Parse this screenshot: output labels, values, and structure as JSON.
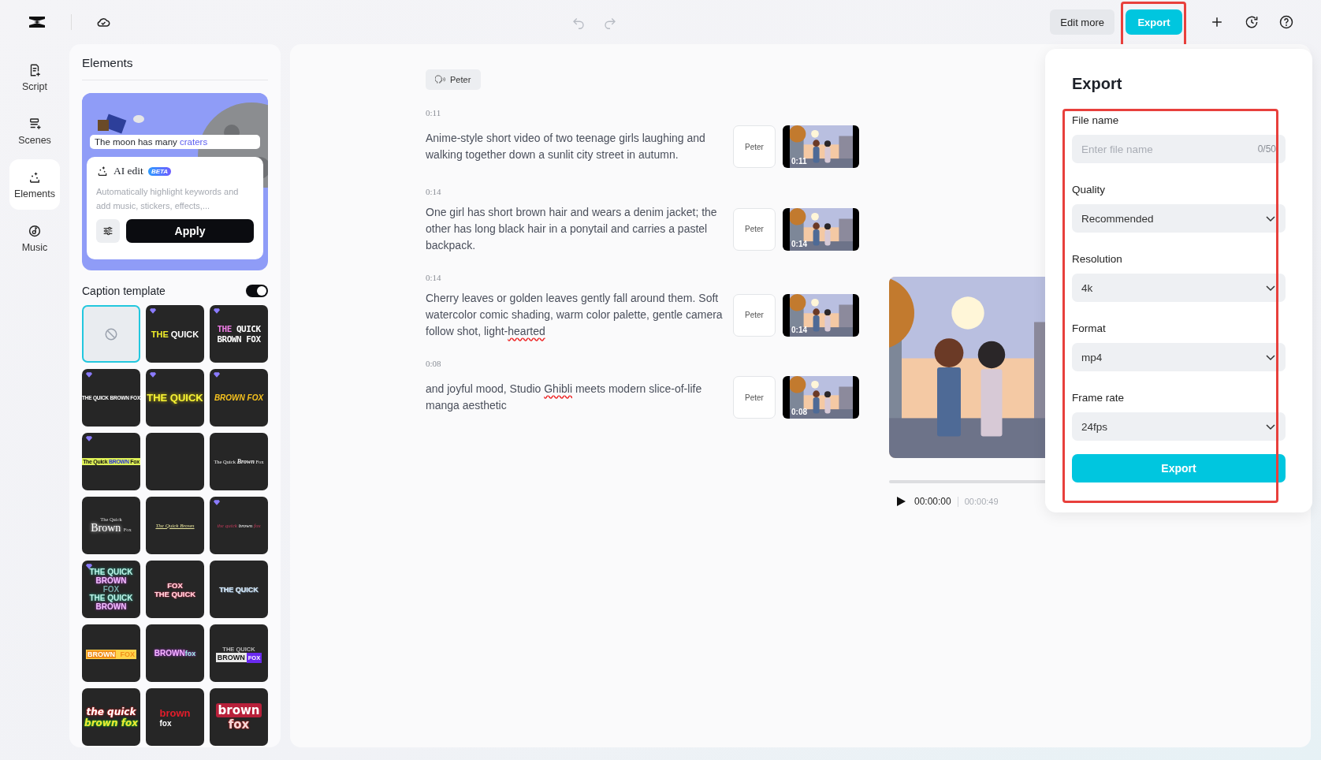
{
  "toolbar": {
    "undo": {
      "disabled": true
    },
    "redo": {
      "disabled": true
    },
    "edit_more": "Edit more",
    "export": {
      "label": "Export",
      "highlighted": true
    }
  },
  "nav": [
    {
      "label": "Script",
      "kind": "script",
      "selected": false
    },
    {
      "label": "Scenes",
      "kind": "scenes",
      "selected": false
    },
    {
      "label": "Elements",
      "kind": "elements",
      "selected": true
    },
    {
      "label": "Music",
      "kind": "music",
      "selected": false
    }
  ],
  "elements_panel": {
    "title": "Elements",
    "promo": {
      "caption": "The moon has many ",
      "caption_keyword": "craters",
      "ai_title": "AI edit",
      "badge": "BETA",
      "description": "Automatically highlight keywords and add music, stickers, effects,...",
      "apply": "Apply"
    },
    "caption_template": {
      "label": "Caption template",
      "on": true,
      "templates": [
        {
          "kind": "none",
          "premium": false,
          "selected": true
        },
        {
          "kind": "text",
          "premium": true,
          "selected": false,
          "lines": [
            [
              "THE ",
              "QUICK"
            ]
          ]
        },
        {
          "kind": "text",
          "premium": true,
          "selected": false,
          "lines": [
            [
              "THE ",
              "QUICK"
            ],
            [
              "BROWN FOX"
            ]
          ]
        },
        {
          "kind": "text",
          "premium": true,
          "selected": false,
          "lines": [
            [
              "THE QUICK BROWN FOX"
            ]
          ]
        },
        {
          "kind": "text",
          "premium": true,
          "selected": false,
          "lines": [
            [
              "THE QUICK"
            ]
          ]
        },
        {
          "kind": "text",
          "premium": true,
          "selected": false,
          "lines": [
            [
              "BROWN FOX"
            ]
          ]
        },
        {
          "kind": "text",
          "premium": true,
          "selected": false,
          "lines": [
            [
              "The Quick ",
              "BROWN",
              " Fox"
            ]
          ]
        },
        {
          "kind": "blank",
          "premium": false,
          "selected": false
        },
        {
          "kind": "text",
          "premium": false,
          "selected": false,
          "lines": [
            [
              "The Quick ",
              "Brown",
              " Fox"
            ]
          ]
        },
        {
          "kind": "text",
          "premium": false,
          "selected": false,
          "lines": [
            [
              "The Quick"
            ],
            [
              "Brown ",
              "Fox"
            ]
          ]
        },
        {
          "kind": "text",
          "premium": false,
          "selected": false,
          "lines": [
            [
              "The Quick Brown"
            ]
          ]
        },
        {
          "kind": "text",
          "premium": true,
          "selected": false,
          "lines": [
            [
              "the quick ",
              "brown",
              " fox"
            ]
          ]
        },
        {
          "kind": "text",
          "premium": true,
          "selected": false,
          "lines": [
            [
              "THE QUICK"
            ],
            [
              "BROWN"
            ],
            [
              "FOX"
            ],
            [
              "THE QUICK"
            ],
            [
              "BROWN"
            ]
          ]
        },
        {
          "kind": "text",
          "premium": false,
          "selected": false,
          "lines": [
            [
              "FOX"
            ],
            [
              "THE QUICK"
            ]
          ]
        },
        {
          "kind": "text",
          "premium": false,
          "selected": false,
          "lines": [
            [
              "THE QUICK"
            ]
          ]
        },
        {
          "kind": "text",
          "premium": false,
          "selected": false,
          "lines": [
            [
              "BROWN",
              " FOX"
            ]
          ]
        },
        {
          "kind": "text",
          "premium": false,
          "selected": false,
          "lines": [
            [
              "BROWN",
              "fox"
            ]
          ]
        },
        {
          "kind": "text",
          "premium": false,
          "selected": false,
          "lines": [
            [
              "THE QUICK"
            ],
            [
              "BROWN",
              "FOX"
            ]
          ]
        },
        {
          "kind": "text",
          "premium": false,
          "selected": false,
          "lines": [
            [
              "the quick"
            ],
            [
              "brown fox"
            ]
          ]
        },
        {
          "kind": "text",
          "premium": false,
          "selected": false,
          "lines": [
            [
              "brown"
            ],
            [
              "fox"
            ]
          ]
        },
        {
          "kind": "text",
          "premium": false,
          "selected": false,
          "lines": [
            [
              "brown"
            ],
            [
              "fox"
            ]
          ]
        }
      ]
    }
  },
  "script": {
    "speaker": "Peter",
    "segments": [
      {
        "time": "0:11",
        "voice": "Peter",
        "thumb_time": "0:11",
        "text": [
          {
            "text": "Anime-style short video of two teenage girls laughing and walking together down a sunlit city street in autumn.",
            "misspelled": false
          }
        ]
      },
      {
        "time": "0:14",
        "voice": "Peter",
        "thumb_time": "0:14",
        "text": [
          {
            "text": "One girl has short brown hair and wears a denim jacket; the other has long black hair in a ponytail and carries a pastel backpack.",
            "misspelled": false
          }
        ]
      },
      {
        "time": "0:14",
        "voice": "Peter",
        "thumb_time": "0:14",
        "text": [
          {
            "text": "Cherry leaves or golden leaves gently fall around them. Soft watercolor comic shading, warm color palette, gentle camera follow shot, light-",
            "misspelled": false
          },
          {
            "text": "hearted",
            "misspelled": true
          }
        ]
      },
      {
        "time": "0:08",
        "voice": "Peter",
        "thumb_time": "0:08",
        "text": [
          {
            "text": "and joyful mood, Studio ",
            "misspelled": false
          },
          {
            "text": "Ghibli",
            "misspelled": true
          },
          {
            "text": " meets modern slice-of-life manga aesthetic",
            "misspelled": false
          }
        ]
      }
    ]
  },
  "player": {
    "playing": false,
    "level": 0,
    "current": "00:00:00",
    "total": "00:00:49"
  },
  "export_dialog": {
    "title": "Export",
    "highlighted": true,
    "fields": [
      {
        "kind": "input",
        "label": "File name",
        "placeholder": "Enter file name",
        "counter": "0/50"
      },
      {
        "kind": "select",
        "label": "Quality",
        "value": "Recommended"
      },
      {
        "kind": "select",
        "label": "Resolution",
        "value": "4k"
      },
      {
        "kind": "select",
        "label": "Format",
        "value": "mp4"
      },
      {
        "kind": "select",
        "label": "Frame rate",
        "value": "24fps"
      }
    ],
    "button": "Export"
  }
}
